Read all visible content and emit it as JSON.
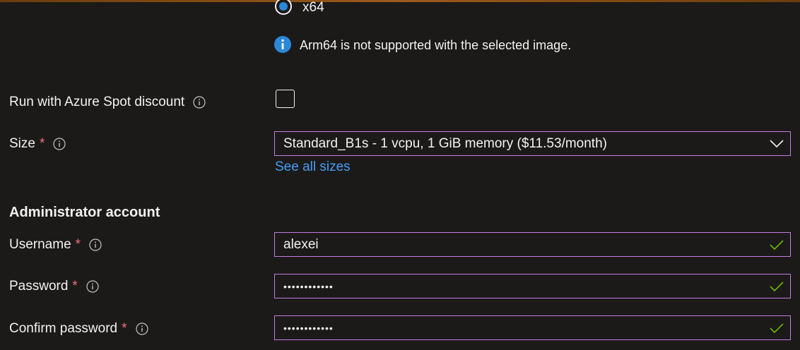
{
  "architecture": {
    "option_label": "x64",
    "selected": true
  },
  "info_message": {
    "icon": "info-circle-filled-icon",
    "text": "Arm64 is not supported with the selected image."
  },
  "spot": {
    "label": "Run with Azure Spot discount",
    "checked": false
  },
  "size": {
    "label": "Size",
    "required_marker": "*",
    "value": "Standard_B1s - 1 vcpu, 1 GiB memory ($11.53/month)",
    "link": "See all sizes"
  },
  "admin": {
    "heading": "Administrator account",
    "username": {
      "label": "Username",
      "required_marker": "*",
      "value": "alexei"
    },
    "password": {
      "label": "Password",
      "required_marker": "*",
      "value": "••••••••••••"
    },
    "confirm_password": {
      "label": "Confirm password",
      "required_marker": "*",
      "value": "••••••••••••"
    }
  },
  "colors": {
    "background": "#1b1a19",
    "input_border": "#c37be0",
    "link": "#479ef5",
    "required": "#f1707b",
    "valid_check": "#6bb700",
    "info_icon": "#2b88d8"
  }
}
